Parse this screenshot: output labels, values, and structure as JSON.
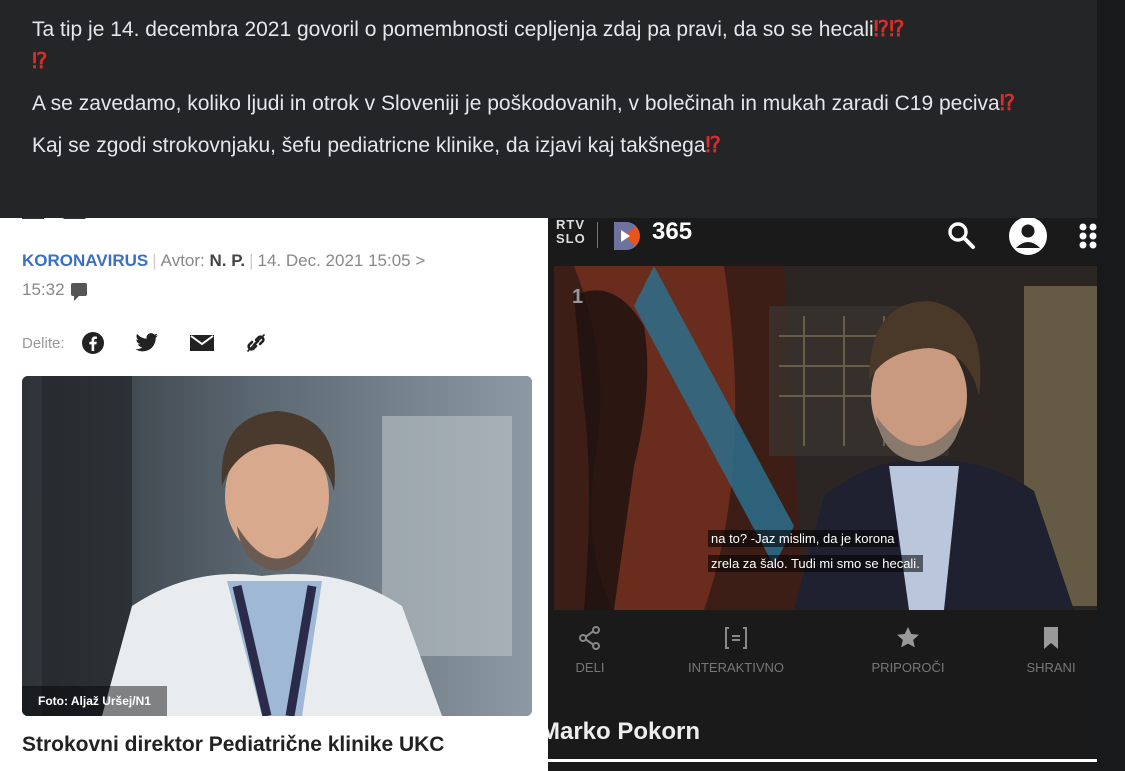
{
  "post": {
    "line1": "Ta tip je 14. decembra 2021 govoril o pomembnosti cepljenja zdaj pa pravi, da so se hecali",
    "line1_emoji": "⁉⁉",
    "line1_emoji_wrap": "⁉",
    "line2": "A se zavedamo, koliko ljudi in otrok v Sloveniji je poškodovanih, v bolečinah in mukah zaradi C19 peciva",
    "line2_emoji": "⁉",
    "line3": "Kaj se zgodi strokovnjaku, šefu pediatricne klinike, da izjavi kaj takšnega",
    "line3_emoji": "⁉"
  },
  "article": {
    "category": "KORONAVIRUS",
    "author_label": "Avtor:",
    "author": "N. P.",
    "date": "14. Dec. 2021 15:05 >",
    "time2": "15:32",
    "share_label": "Delite:",
    "share_icons": [
      "facebook-icon",
      "twitter-icon",
      "mail-icon",
      "link-icon"
    ],
    "photo_credit": "Foto: Aljaž Uršej/N1",
    "headline": "Strokovni direktor Pediatrične klinike UKC",
    "accent": "#3a6fc4"
  },
  "app": {
    "brand_top": "RTV",
    "brand_bottom": "SLO",
    "brand_name": "365",
    "brand_color": "#e8541e",
    "video_counter": "1",
    "subtitle_line1": "na to? -Jaz mislim, da je korona",
    "subtitle_line2": "zrela za šalo. Tudi mi smo se hecali.",
    "actions": [
      {
        "label": "DELI",
        "icon": "share-icon"
      },
      {
        "label": "INTERAKTIVNO",
        "icon": "interactive-icon"
      },
      {
        "label": "PRIPOROČI",
        "icon": "star-icon"
      },
      {
        "label": "SHRANI",
        "icon": "bookmark-icon"
      }
    ],
    "person_name": "Marko Pokorn"
  }
}
